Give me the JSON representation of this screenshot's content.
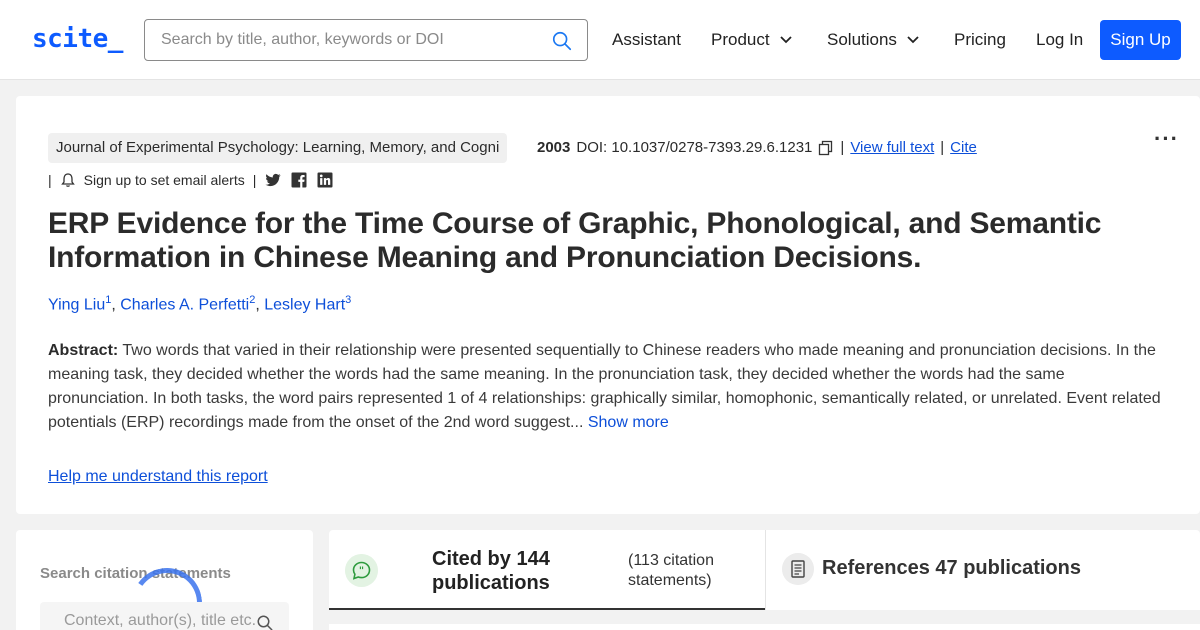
{
  "header": {
    "logo": "scite_",
    "search_placeholder": "Search by title, author, keywords or DOI",
    "nav": {
      "assistant": "Assistant",
      "product": "Product",
      "solutions": "Solutions",
      "pricing": "Pricing",
      "login": "Log In",
      "signup": "Sign Up"
    }
  },
  "paper": {
    "journal": "Journal of Experimental Psychology: Learning, Memory, and Cogni",
    "year": "2003",
    "doi": "DOI: 10.1037/0278-7393.29.6.1231",
    "view_full_text": "View full text",
    "cite": "Cite",
    "email_alerts": "Sign up to set email alerts",
    "separator": "|",
    "title": "ERP Evidence for the Time Course of Graphic, Phonological, and Semantic Information in Chinese Meaning and Pronunciation Decisions.",
    "authors": [
      {
        "name": "Ying Liu",
        "sup": "1"
      },
      {
        "name": "Charles A. Perfetti",
        "sup": "2"
      },
      {
        "name": "Lesley Hart",
        "sup": "3"
      }
    ],
    "abstract_label": "Abstract:",
    "abstract_text": "Two words that varied in their relationship were presented sequentially to Chinese readers who made meaning and pronunciation decisions. In the meaning task, they decided whether the words had the same meaning. In the pronunciation task, they decided whether the words had the same pronunciation. In both tasks, the word pairs represented 1 of 4 relationships: graphically similar, homophonic, semantically related, or unrelated. Event related potentials (ERP) recordings made from the onset of the 2nd word suggest...",
    "show_more": "Show more",
    "help_link": "Help me understand this report"
  },
  "citations": {
    "search_title": "Search citation statements",
    "search_placeholder": "Context, author(s), title etc.",
    "cited_by": "Cited by 144 publications",
    "cited_sub": "(113 citation statements)",
    "references": "References 47 publications"
  },
  "colors": {
    "brand": "#0d5bff",
    "link": "#0d4fd9"
  }
}
